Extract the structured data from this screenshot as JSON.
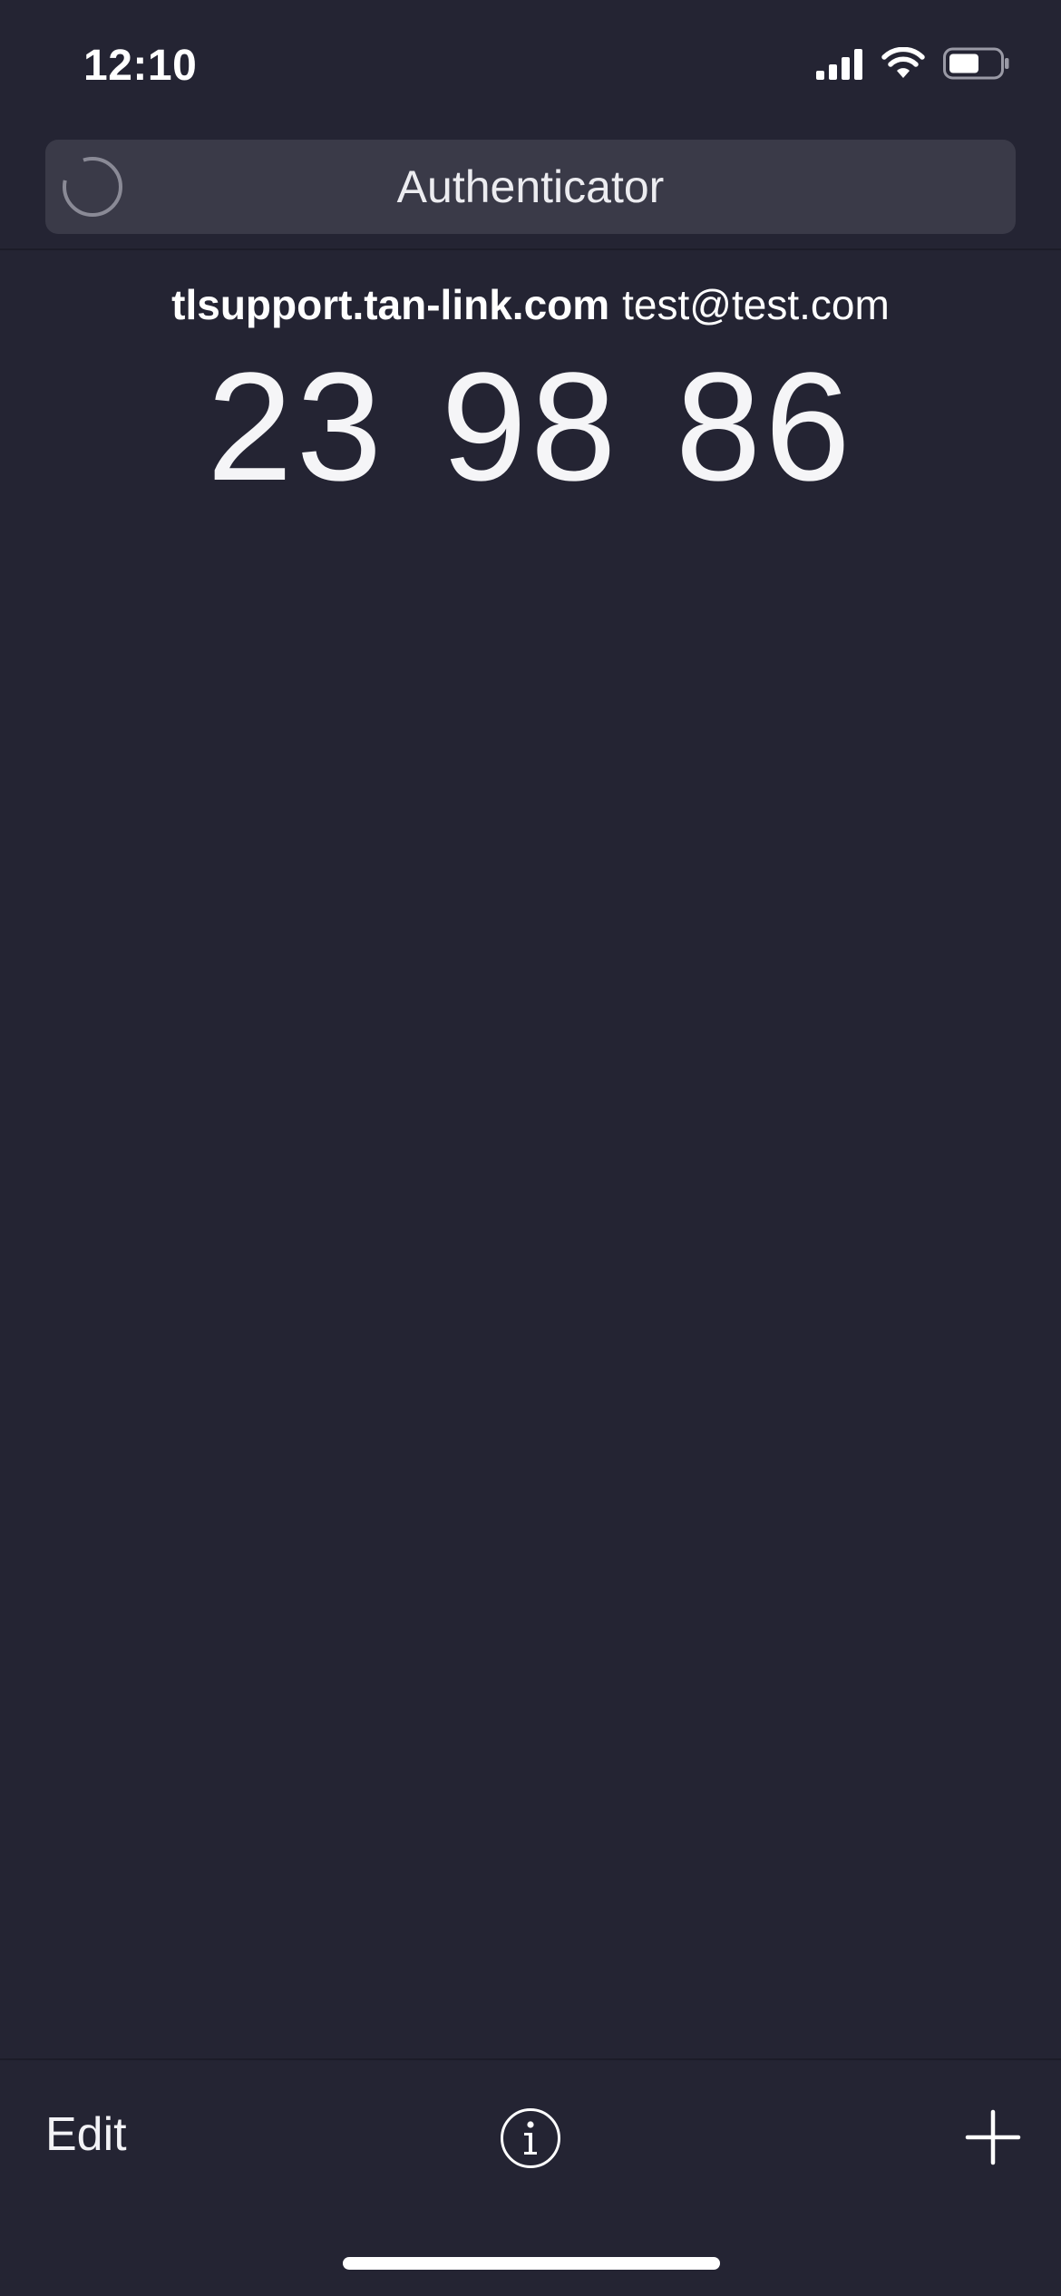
{
  "status_bar": {
    "time": "12:10"
  },
  "header": {
    "title": "Authenticator"
  },
  "tokens": [
    {
      "issuer": "tlsupport.tan-link.com",
      "account": "test@test.com",
      "code": "23 98 86"
    }
  ],
  "toolbar": {
    "edit_label": "Edit",
    "info_icon": "info-icon",
    "add_icon": "plus-icon"
  },
  "colors": {
    "background": "#242433",
    "title_pill": "#3a3a48",
    "text": "#ffffff"
  }
}
